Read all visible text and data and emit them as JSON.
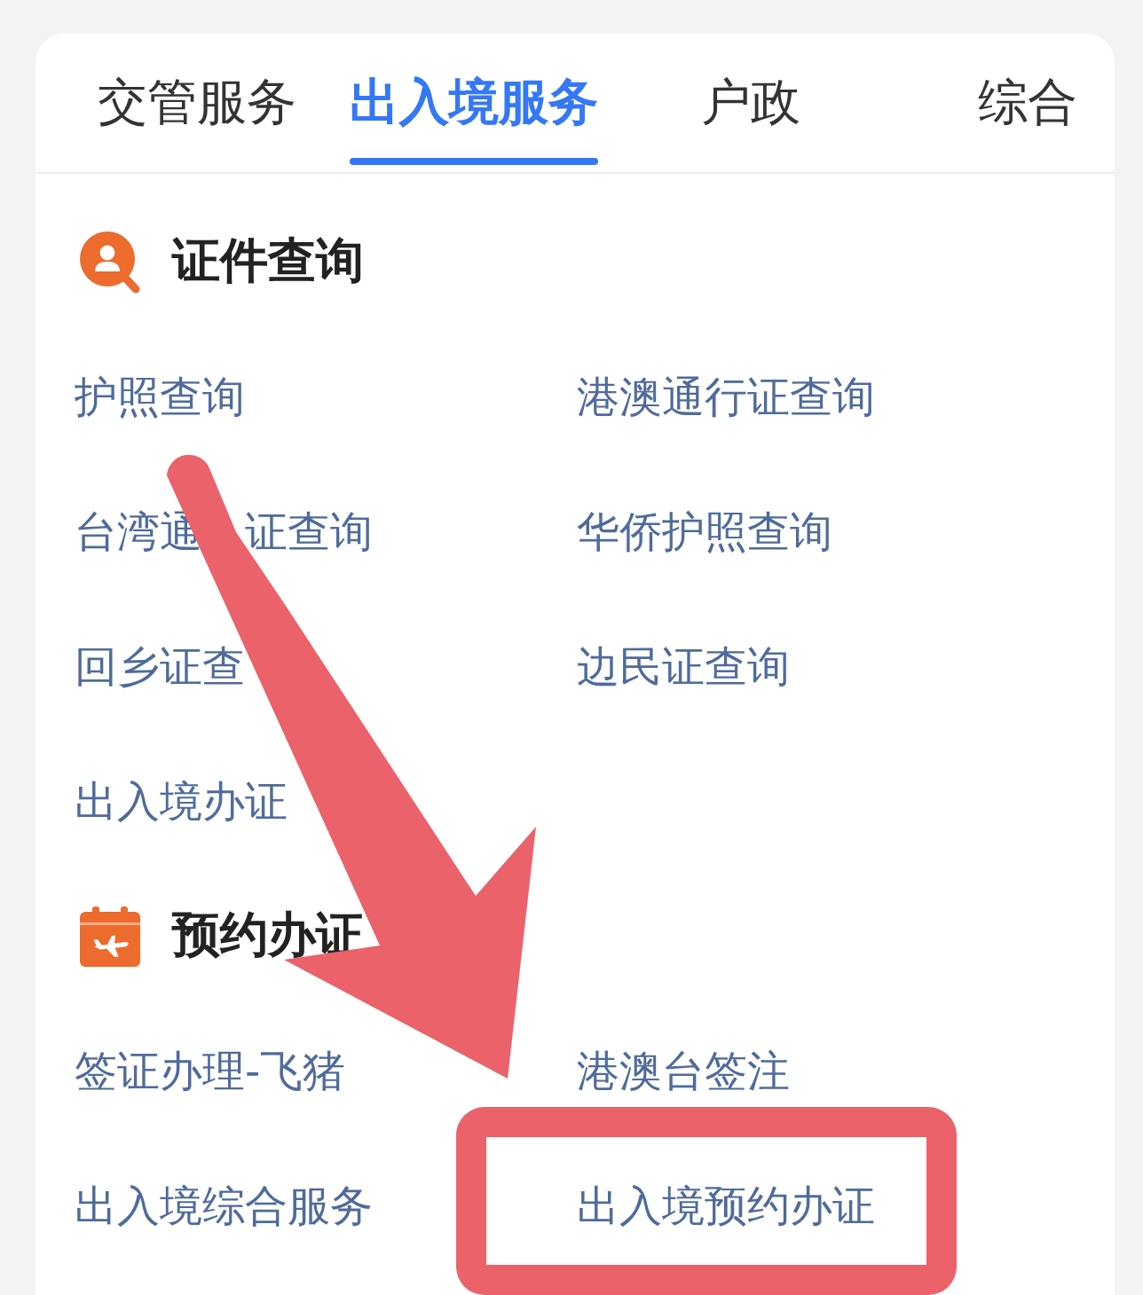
{
  "tabs": [
    {
      "label": "交管服务",
      "selected": false
    },
    {
      "label": "出入境服务",
      "selected": true
    },
    {
      "label": "户政",
      "selected": false
    },
    {
      "label": "综合",
      "selected": false
    }
  ],
  "sections": [
    {
      "kind": "id_query",
      "title": "证件查询",
      "links": [
        {
          "label": "护照查询"
        },
        {
          "label": "港澳通行证查询"
        },
        {
          "label_parts": [
            "台湾通",
            "证查询"
          ]
        },
        {
          "label": "华侨护照查询"
        },
        {
          "label": "回乡证查"
        },
        {
          "label": "边民证查询"
        },
        {
          "label": "出入境办证"
        }
      ]
    },
    {
      "kind": "appointment",
      "title": "预约办证",
      "links": [
        {
          "label": "签证办理-飞猪"
        },
        {
          "label": "港澳台签注"
        },
        {
          "label": "出入境综合服务"
        },
        {
          "label": "出入境预约办证"
        }
      ]
    }
  ],
  "annotations": {
    "arrow": true,
    "frame": true
  }
}
